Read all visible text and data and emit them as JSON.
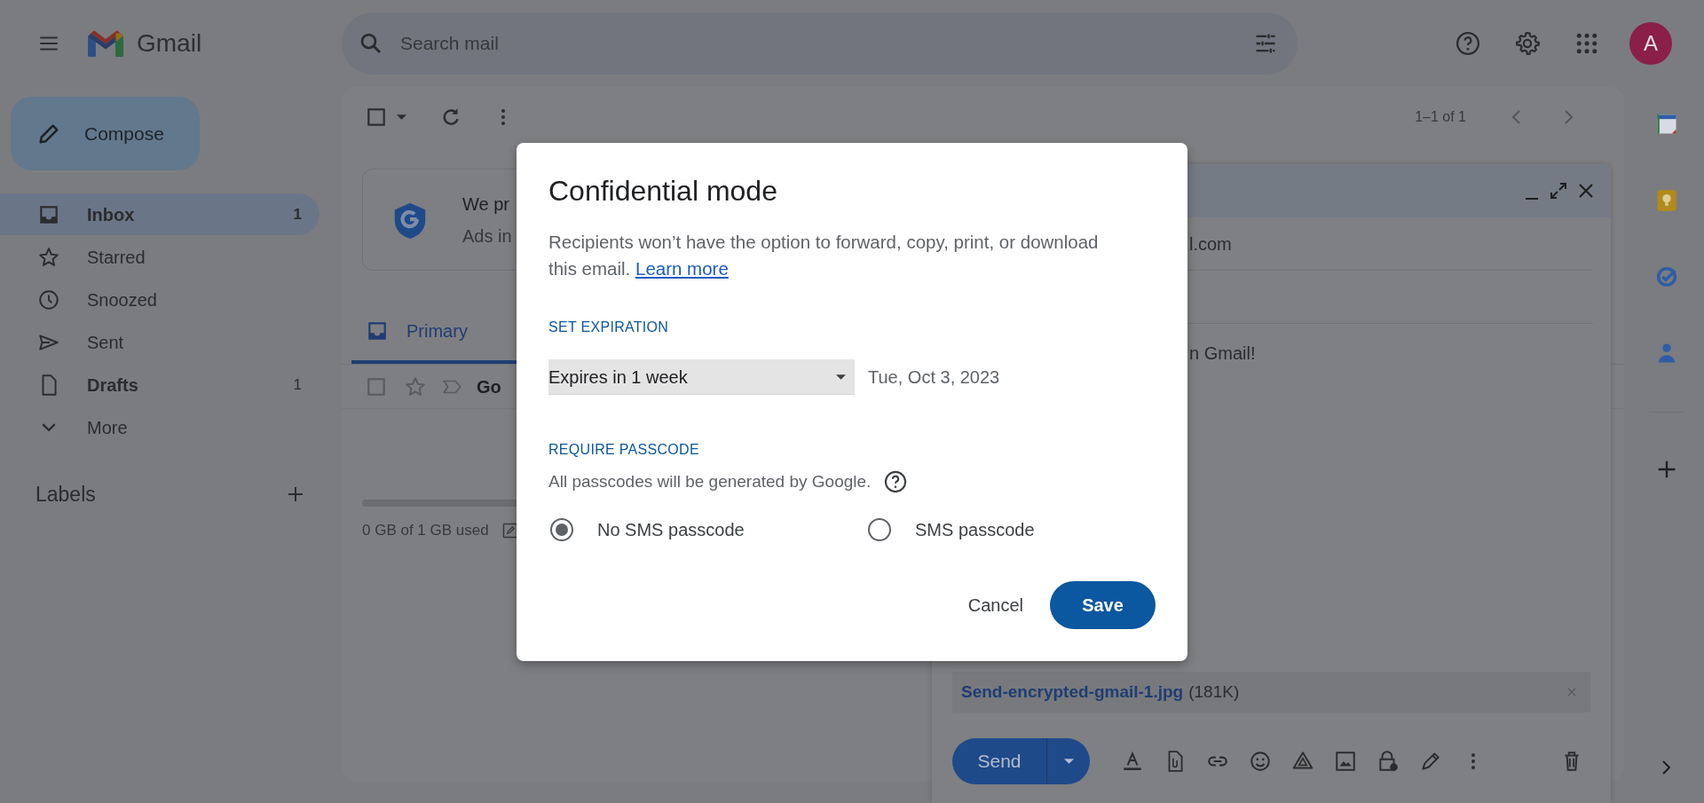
{
  "app": {
    "name": "Gmail"
  },
  "search": {
    "placeholder": "Search mail"
  },
  "account": {
    "initial": "A"
  },
  "compose_button": {
    "label": "Compose"
  },
  "sidebar": {
    "items": [
      {
        "label": "Inbox",
        "count": "1",
        "selected": true,
        "unread": true
      },
      {
        "label": "Starred",
        "selected": false,
        "unread": false
      },
      {
        "label": "Snoozed",
        "selected": false,
        "unread": false
      },
      {
        "label": "Sent",
        "selected": false,
        "unread": false
      },
      {
        "label": "Drafts",
        "count": "1",
        "selected": false,
        "unread": true
      },
      {
        "label": "More",
        "selected": false,
        "unread": false
      }
    ],
    "labels_heading": "Labels"
  },
  "toolbar": {
    "select_all_checked": false,
    "page_info": "1–1 of 1"
  },
  "promo": {
    "title": "We pr",
    "subtitle": "Ads in"
  },
  "tabs": [
    {
      "label": "Primary",
      "selected": true
    }
  ],
  "email_rows": [
    {
      "sender": "Go",
      "checked": false,
      "starred": false
    }
  ],
  "storage": {
    "text": "0 GB of 1 GB used"
  },
  "compose": {
    "to_fragment": "l.com",
    "body_fragment": "n Gmail!",
    "attachment": {
      "name": "Send-encrypted-gmail-1.jpg",
      "size": "(181K)"
    },
    "send_label": "Send"
  },
  "dialog": {
    "title": "Confidential mode",
    "description": "Recipients won’t have the option to forward, copy, print, or download this email.",
    "link": "Learn more",
    "expiration_heading": "SET EXPIRATION",
    "expiration_option": "Expires in 1 week",
    "expiration_date": "Tue, Oct 3, 2023",
    "passcode_heading": "REQUIRE PASSCODE",
    "passcode_note": "All passcodes will be generated by Google.",
    "options": [
      {
        "label": "No SMS passcode",
        "selected": true
      },
      {
        "label": "SMS passcode",
        "selected": false
      }
    ],
    "buttons": [
      {
        "label": "Cancel",
        "kind": "text"
      },
      {
        "label": "Save",
        "kind": "primary"
      }
    ]
  }
}
